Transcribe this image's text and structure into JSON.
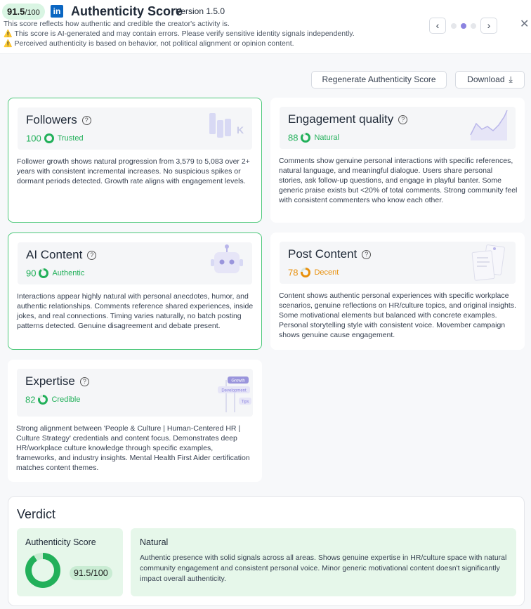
{
  "header": {
    "score_value": "91.5",
    "score_max": "/100",
    "linkedin_logo": "in",
    "title": "Authenticity Score",
    "version": "Version 1.5.0",
    "subtitle": "This score reflects how authentic and credible the creator's activity is.",
    "warning_1": "This score is AI-generated and may contain errors. Please verify sensitive identity signals independently.",
    "warning_2": "Perceived authenticity is based on behavior, not political alignment or opinion content.",
    "warning_icon": "⚠️",
    "prev_icon": "‹",
    "next_icon": "›",
    "close_icon": "✕",
    "active_page": 2,
    "total_pages": 3
  },
  "toolbar": {
    "regenerate_label": "Regenerate Authenticity Score",
    "download_label": "Download"
  },
  "cards": {
    "followers": {
      "title": "Followers",
      "score": "100",
      "score_fraction": 1.0,
      "label": "Trusted",
      "color": "#22b05a",
      "illustration_text": "K",
      "description": "Follower growth shows natural progression from 3,579 to 5,083 over 2+ years with consistent incremental increases. No suspicious spikes or dormant periods detected. Growth rate aligns with engagement levels."
    },
    "engagement": {
      "title": "Engagement quality",
      "score": "88",
      "score_fraction": 0.88,
      "label": "Natural",
      "color": "#22b05a",
      "description": "Comments show genuine personal interactions with specific references, natural language, and meaningful dialogue. Users share personal stories, ask follow-up questions, and engage in playful banter. Some generic praise exists but <20% of total comments. Strong community feel with consistent commenters who know each other."
    },
    "ai_content": {
      "title": "AI Content",
      "score": "90",
      "score_fraction": 0.9,
      "label": "Authentic",
      "color": "#22b05a",
      "description": "Interactions appear highly natural with personal anecdotes, humor, and authentic relationships. Comments reference shared experiences, inside jokes, and real connections. Timing varies naturally, no batch posting patterns detected. Genuine disagreement and debate present."
    },
    "post_content": {
      "title": "Post Content",
      "score": "78",
      "score_fraction": 0.78,
      "label": "Decent",
      "color": "#e8900c",
      "description": "Content shows authentic personal experiences with specific workplace scenarios, genuine reflections on HR/culture topics, and original insights. Some motivational elements but balanced with concrete examples. Personal storytelling style with consistent voice. Movember campaign shows genuine cause engagement."
    },
    "expertise": {
      "title": "Expertise",
      "score": "82",
      "score_fraction": 0.82,
      "label": "Credible",
      "color": "#22b05a",
      "illustration_tags": [
        "Growth",
        "Development",
        "Tips"
      ],
      "description": "Strong alignment between 'People & Culture | Human-Centered HR | Culture Strategy' credentials and content focus. Demonstrates deep HR/workplace culture knowledge through specific examples, frameworks, and industry insights. Mental Health First Aider certification matches content themes."
    }
  },
  "verdict": {
    "title": "Verdict",
    "score_label": "Authenticity Score",
    "score_value": "91.5/100",
    "score_fraction": 0.915,
    "verdict_label": "Natural",
    "verdict_text": "Authentic presence with solid signals across all areas. Shows genuine expertise in HR/culture space with natural community engagement and consistent personal voice. Minor generic motivational content doesn't significantly impact overall authenticity."
  },
  "colors": {
    "green": "#22b05a",
    "orange": "#e8900c",
    "accent_purple": "#8b83e0",
    "highlight_border": "#4cc87a"
  }
}
